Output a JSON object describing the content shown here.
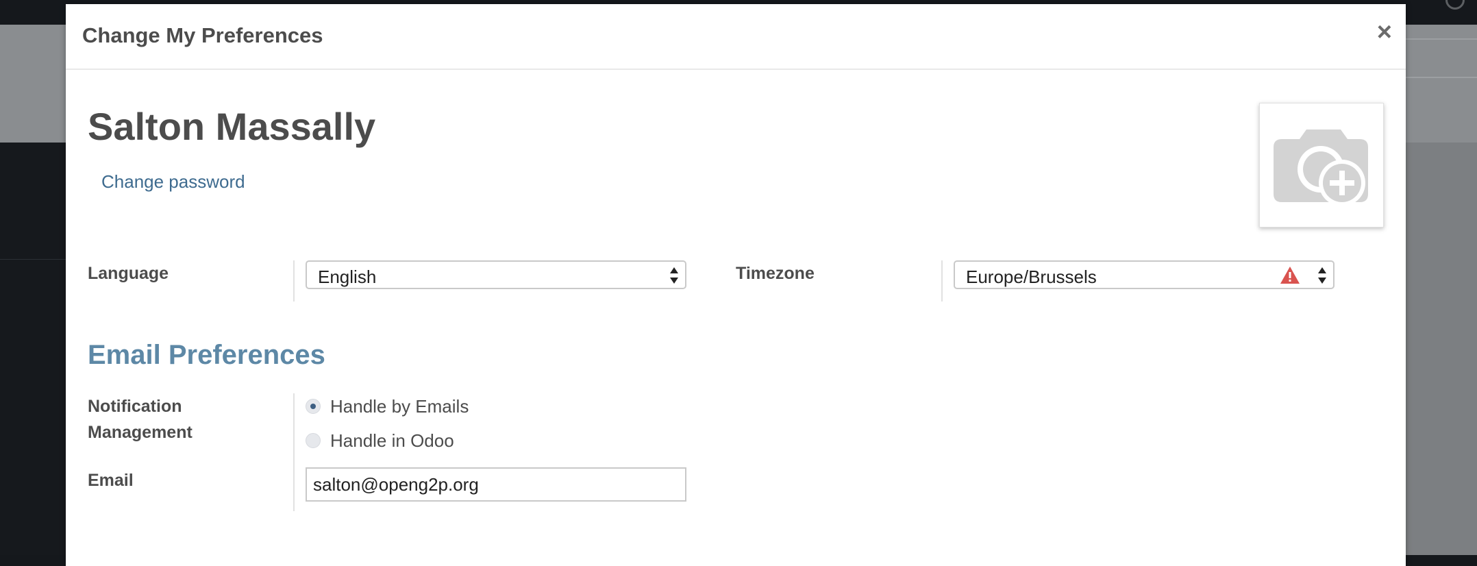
{
  "modal": {
    "title": "Change My Preferences",
    "close_label": "×"
  },
  "user": {
    "name": "Salton Massally",
    "change_password_label": "Change password"
  },
  "avatar": {
    "icon": "camera-plus-icon"
  },
  "fields": {
    "language": {
      "label": "Language",
      "value": "English"
    },
    "timezone": {
      "label": "Timezone",
      "value": "Europe/Brussels",
      "warning_icon": "warning-triangle-icon",
      "warning_color": "#d9534f"
    }
  },
  "email_preferences": {
    "title": "Email Preferences",
    "notification": {
      "label": "Notification Management",
      "options": [
        {
          "label": "Handle by Emails",
          "selected": true
        },
        {
          "label": "Handle in Odoo",
          "selected": false
        }
      ]
    },
    "email": {
      "label": "Email",
      "value": "salton@openg2p.org"
    }
  },
  "colors": {
    "link": "#3e6b8f",
    "section_title": "#5d88a6",
    "text": "#4c4c4c"
  }
}
